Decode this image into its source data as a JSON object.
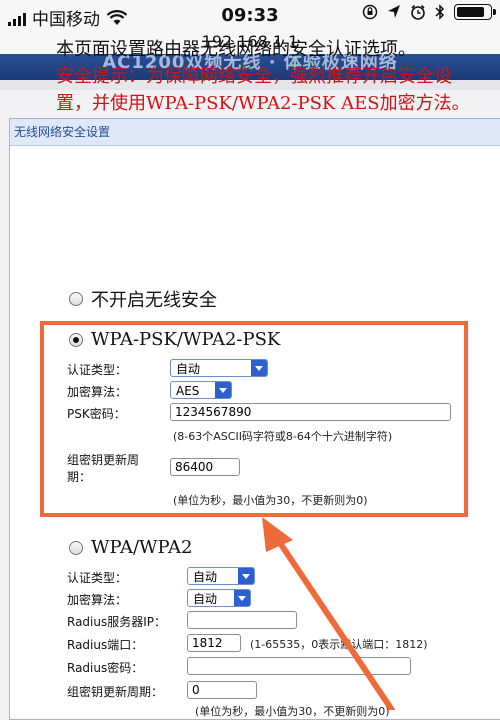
{
  "status_bar": {
    "carrier": "中国移动",
    "time": "09:33",
    "battery_level": 0.9,
    "icons": [
      "signal-icon",
      "wifi-icon",
      "orientation-lock-icon",
      "location-icon",
      "alarm-icon",
      "bluetooth-icon",
      "battery-icon"
    ]
  },
  "browser": {
    "url": "192.168.1.1"
  },
  "banner": {
    "text": "AC1200双频无线 · 体验极速网络"
  },
  "panel": {
    "title": "无线网络安全设置",
    "intro_line": "本页面设置路由器无线网络的安全认证选项。",
    "intro_warning": "安全提示：为保障网络安全，强烈推荐开启安全设置，并使用WPA-PSK/WPA2-PSK AES加密方法。"
  },
  "options": {
    "none": {
      "label": "不开启无线安全",
      "selected": false
    },
    "wpa_psk": {
      "label": "WPA-PSK/WPA2-PSK",
      "selected": true,
      "auth_type_label": "认证类型：",
      "auth_type_value": "自动",
      "encryption_label": "加密算法：",
      "encryption_value": "AES",
      "psk_label": "PSK密码：",
      "psk_value": "1234567890",
      "psk_hint": "(8-63个ASCII码字符或8-64个十六进制字符)",
      "group_key_label_1": "组密钥更新周",
      "group_key_label_2": "期：",
      "group_key_value": "86400",
      "group_key_hint": "(单位为秒，最小值为30，不更新则为0)"
    },
    "wpa": {
      "label": "WPA/WPA2",
      "selected": false,
      "auth_type_label": "认证类型：",
      "auth_type_value": "自动",
      "encryption_label": "加密算法：",
      "encryption_value": "自动",
      "radius_ip_label": "Radius服务器IP：",
      "radius_ip_value": "",
      "radius_port_label": "Radius端口：",
      "radius_port_value": "1812",
      "radius_port_hint": "(1-65535，0表示默认端口：1812)",
      "radius_pwd_label": "Radius密码：",
      "radius_pwd_value": "",
      "group_key_label": "组密钥更新周期：",
      "group_key_value": "0",
      "group_key_hint": "(单位为秒，最小值为30，不更新则为0)"
    }
  },
  "annotation": {
    "highlight_color": "#ef6a3a",
    "arrow_color": "#ef6a3a"
  }
}
